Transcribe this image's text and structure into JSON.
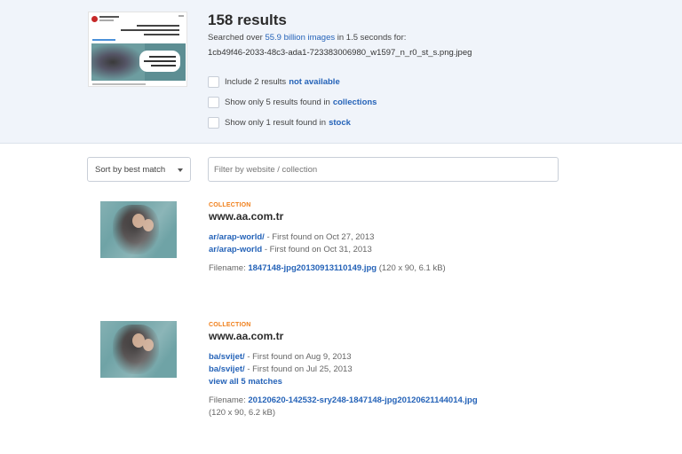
{
  "summary": {
    "results_count": "158 results",
    "searched_prefix": "Searched over",
    "searched_link": "55.9 billion images",
    "searched_suffix": "in 1.5 seconds for:",
    "query_filename": "1cb49f46-2033-48c3-ada1-723383006980_w1597_n_r0_st_s.png.jpeg"
  },
  "options": [
    {
      "prefix": "Include 2 results",
      "link": "not available"
    },
    {
      "prefix": "Show only 5 results found in",
      "link": "collections"
    },
    {
      "prefix": "Show only 1 result found in",
      "link": "stock"
    }
  ],
  "controls": {
    "sort_label": "Sort by best match",
    "filter_placeholder": "Filter by website / collection"
  },
  "results": [
    {
      "tag": "COLLECTION",
      "domain": "www.aa.com.tr",
      "matches": [
        {
          "path": "ar/arap-world/",
          "found": "- First found on Oct 27, 2013"
        },
        {
          "path": "ar/arap-world",
          "found": "- First found on Oct 31, 2013"
        }
      ],
      "filename_label": "Filename:",
      "filename": "1847148-jpg20130913110149.jpg",
      "filename_meta": "(120 x 90, 6.1 kB)"
    },
    {
      "tag": "COLLECTION",
      "domain": "www.aa.com.tr",
      "matches": [
        {
          "path": "ba/svijet/",
          "found": "- First found on Aug 9, 2013"
        },
        {
          "path": "ba/svijet/",
          "found": "- First found on Jul 25, 2013"
        }
      ],
      "view_all": "view all 5 matches",
      "filename_label": "Filename:",
      "filename": "20120620-142532-sry248-1847148-jpg20120621144014.jpg",
      "filename_meta": "(120 x 90, 6.2 kB)"
    }
  ],
  "colors": {
    "link": "#2563b8",
    "tag": "#f07f1a",
    "header_bg": "#f0f4fa"
  }
}
